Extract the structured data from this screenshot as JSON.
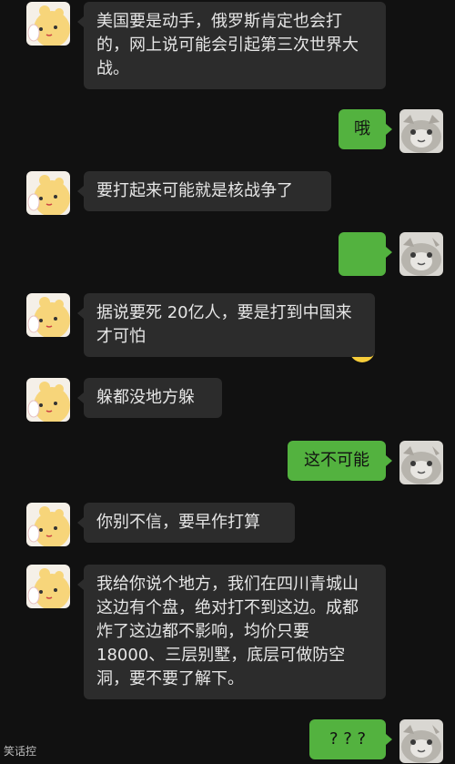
{
  "messages": [
    {
      "side": "in",
      "text": "美国要是动手，俄罗斯肯定也会打的，网上说可能会引起第三次世界大战。"
    },
    {
      "side": "out",
      "text": "哦"
    },
    {
      "side": "in",
      "text": "要打起来可能就是核战争了"
    },
    {
      "side": "out",
      "text": "",
      "emoji": "nervous-sweat-emoji"
    },
    {
      "side": "in",
      "text": "据说要死 20亿人，要是打到中国来才可怕"
    },
    {
      "side": "in",
      "text": "躲都没地方躲"
    },
    {
      "side": "out",
      "text": "这不可能"
    },
    {
      "side": "in",
      "text": "你别不信，要早作打算"
    },
    {
      "side": "in",
      "text": "我给你说个地方，我们在四川青城山这边有个盘，绝对打不到这边。成都炸了这边都不影响，均价只要18000、三层别墅，底层可做防空洞，要不要了解下。"
    },
    {
      "side": "out",
      "text": "? ? ?"
    }
  ],
  "avatars": {
    "left": "hamster-sticker-avatar",
    "right": "gray-cat-avatar"
  },
  "watermark": "笑话控",
  "colors": {
    "background": "#111111",
    "incoming_bubble": "#2c2c2c",
    "outgoing_bubble": "#53b23f"
  }
}
